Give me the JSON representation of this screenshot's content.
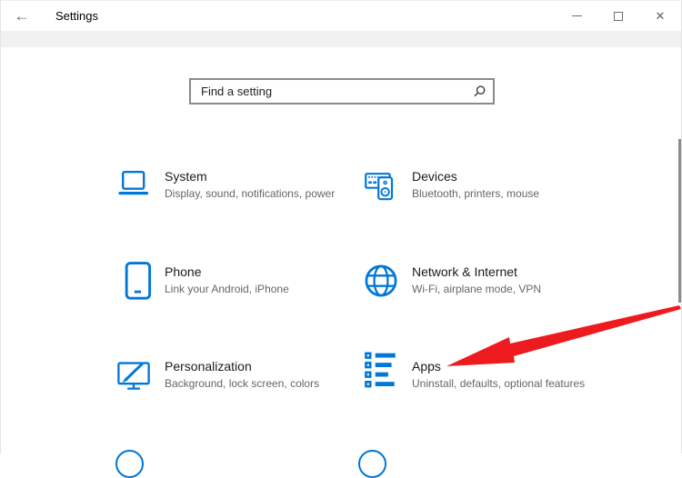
{
  "titlebar": {
    "title": "Settings",
    "back_glyph": "←",
    "close_glyph": "✕",
    "controls": [
      "minimize",
      "maximize",
      "close"
    ]
  },
  "search": {
    "placeholder": "Find a setting"
  },
  "tiles": [
    {
      "title": "System",
      "subtitle": "Display, sound, notifications, power",
      "icon": "laptop-icon"
    },
    {
      "title": "Devices",
      "subtitle": "Bluetooth, printers, mouse",
      "icon": "keyboard-speaker-icon"
    },
    {
      "title": "Phone",
      "subtitle": "Link your Android, iPhone",
      "icon": "phone-icon"
    },
    {
      "title": "Network & Internet",
      "subtitle": "Wi-Fi, airplane mode, VPN",
      "icon": "globe-icon"
    },
    {
      "title": "Personalization",
      "subtitle": "Background, lock screen, colors",
      "icon": "monitor-brush-icon"
    },
    {
      "title": "Apps",
      "subtitle": "Uninstall, defaults, optional features",
      "icon": "list-checkbox-icon"
    }
  ],
  "annotation": {
    "shape": "arrow",
    "color": "#ee1b1e",
    "points_to": "Apps"
  },
  "colors": {
    "accent": "#0078d7",
    "title_text": "#1b1b1b",
    "subtitle_text": "#666666",
    "band": "#f1f1f1",
    "scrollbar": "#8d8d8d",
    "search_border": "#8a8a8a"
  }
}
